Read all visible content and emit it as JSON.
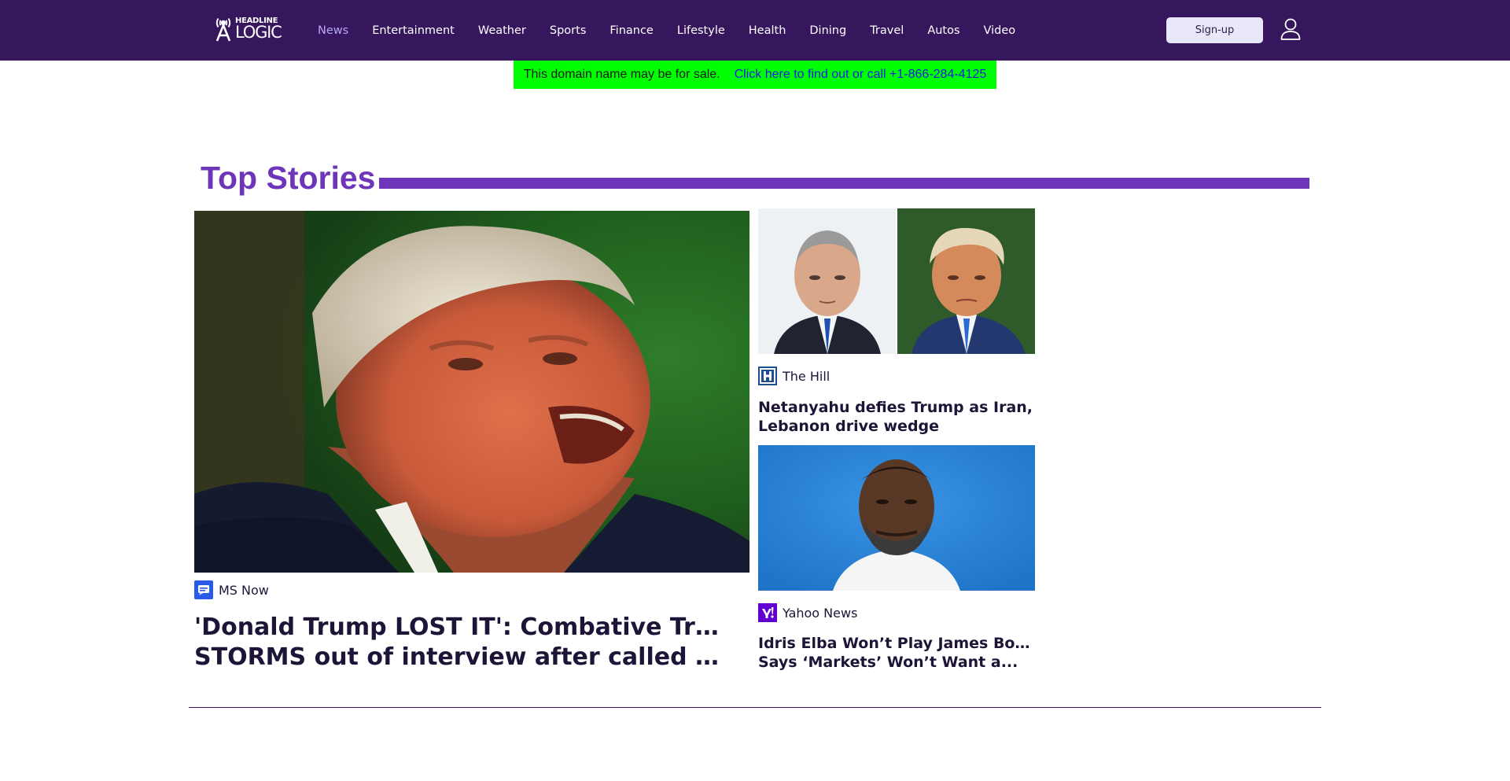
{
  "header": {
    "logo": {
      "line1": "HEADLINE",
      "line2": "LOGIC"
    },
    "nav": [
      {
        "label": "News",
        "active": true
      },
      {
        "label": "Entertainment"
      },
      {
        "label": "Weather"
      },
      {
        "label": "Sports"
      },
      {
        "label": "Finance"
      },
      {
        "label": "Lifestyle"
      },
      {
        "label": "Health"
      },
      {
        "label": "Dining"
      },
      {
        "label": "Travel"
      },
      {
        "label": "Autos"
      },
      {
        "label": "Video"
      }
    ],
    "signup_label": "Sign-up",
    "user_icon": "user-icon"
  },
  "domain_banner": {
    "text": "This domain name may be for sale.",
    "link": "Click here to find out or call +1-866-284-4125"
  },
  "top_stories": {
    "title": "Top Stories",
    "main": {
      "source": "MS Now",
      "source_icon": "ms-now-icon",
      "headline_line1": "'Donald Trump LOST IT': Combative Trump",
      "headline_line2": "STORMS out of interview after called out f..."
    },
    "side": [
      {
        "source": "The Hill",
        "source_icon": "the-hill-icon",
        "headline_line1": "Netanyahu defies Trump as Iran,",
        "headline_line2": "Lebanon drive wedge"
      },
      {
        "source": "Yahoo News",
        "source_icon": "yahoo-icon",
        "headline_line1": "Idris Elba Won’t Play James Bond,",
        "headline_line2": "Says ‘Markets’ Won’t Want a..."
      }
    ]
  },
  "colors": {
    "header_bg": "#36175e",
    "accent": "#6d35ba",
    "nav_active": "#b7a8f0",
    "banner_bg": "#00ff00",
    "banner_link": "#1a1ae6"
  }
}
